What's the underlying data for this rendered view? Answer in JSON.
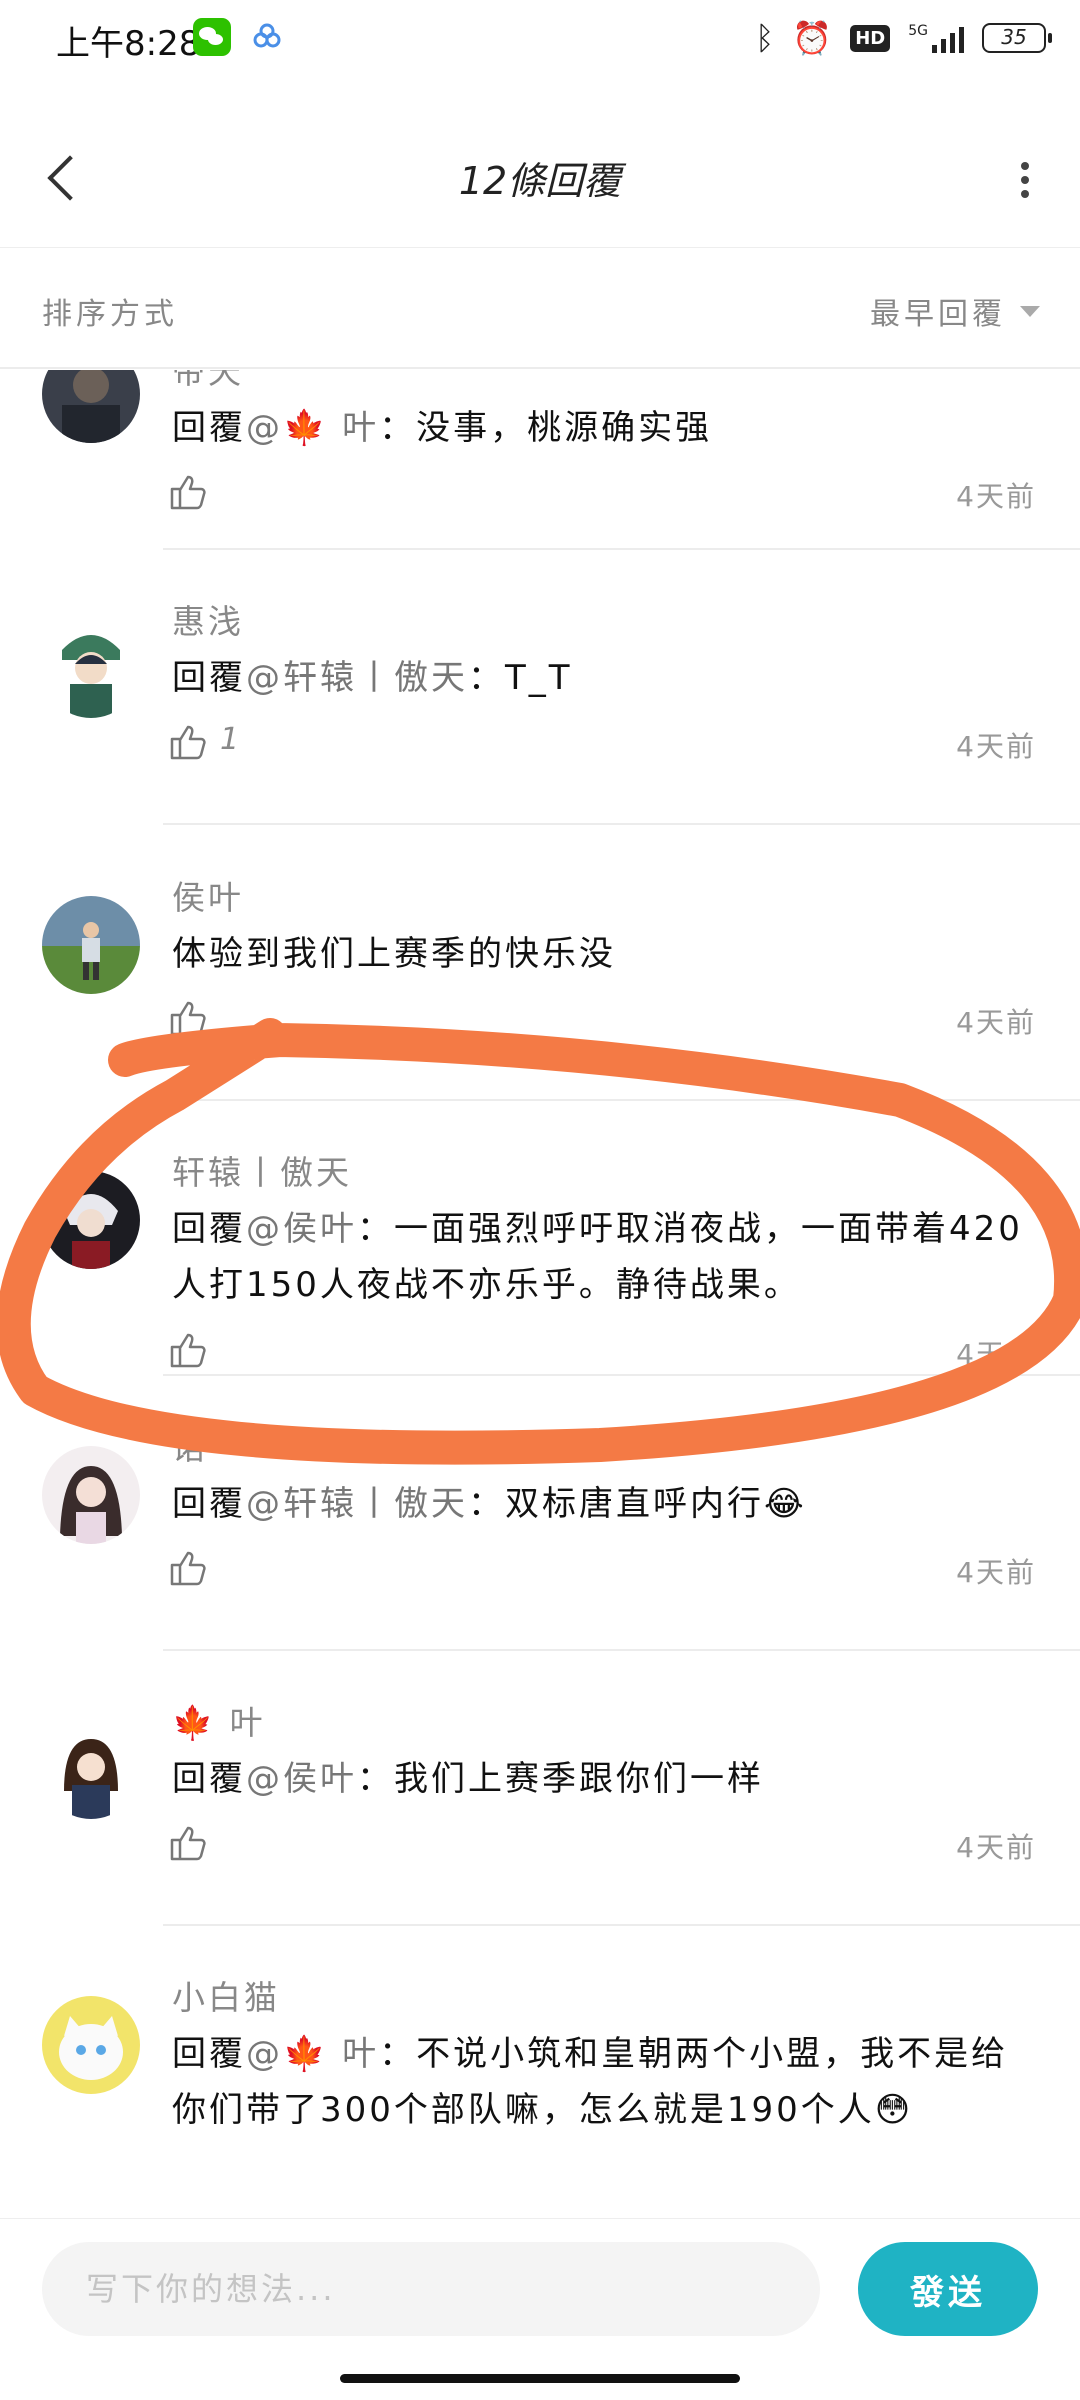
{
  "status_bar": {
    "time": "上午8:28",
    "hd": "HD",
    "network": "5G",
    "battery": "35"
  },
  "header": {
    "title": "12條回覆"
  },
  "sort": {
    "label": "排序方式",
    "selected": "最早回覆"
  },
  "comments": [
    {
      "name": "帝天",
      "reply_prefix": "回覆",
      "mention": "@🍁 叶",
      "text": "：没事，桃源确实强",
      "likes": "",
      "time": "4天前"
    },
    {
      "name": "惠浅",
      "reply_prefix": "回覆",
      "mention": "@轩辕丨傲天",
      "text": "：T_T",
      "likes": "1",
      "time": "4天前"
    },
    {
      "name": "侯叶",
      "reply_prefix": "",
      "mention": "",
      "text": "体验到我们上赛季的快乐没",
      "likes": "",
      "time": "4天前"
    },
    {
      "name": "轩辕丨傲天",
      "reply_prefix": "回覆",
      "mention": "@侯叶",
      "text": "：一面强烈呼吁取消夜战，一面带着420人打150人夜战不亦乐乎。静待战果。",
      "likes": "",
      "time": "4天前"
    },
    {
      "name": "诺",
      "reply_prefix": "回覆",
      "mention": "@轩辕丨傲天",
      "text": "：双标唐直呼内行😂",
      "likes": "",
      "time": "4天前"
    },
    {
      "name": "🍁 叶",
      "reply_prefix": "回覆",
      "mention": "@侯叶",
      "text": "：我们上赛季跟你们一样",
      "likes": "",
      "time": "4天前"
    },
    {
      "name": "小白猫",
      "reply_prefix": "回覆",
      "mention": "@🍁 叶",
      "text": "：不说小筑和皇朝两个小盟，我不是给你们带了300个部队嘛，怎么就是190个人😳",
      "likes": "",
      "time": ""
    }
  ],
  "composer": {
    "placeholder": "写下你的想法...",
    "send_label": "發送"
  },
  "colors": {
    "accent": "#1fb3c4",
    "annotation": "#f47a45"
  }
}
